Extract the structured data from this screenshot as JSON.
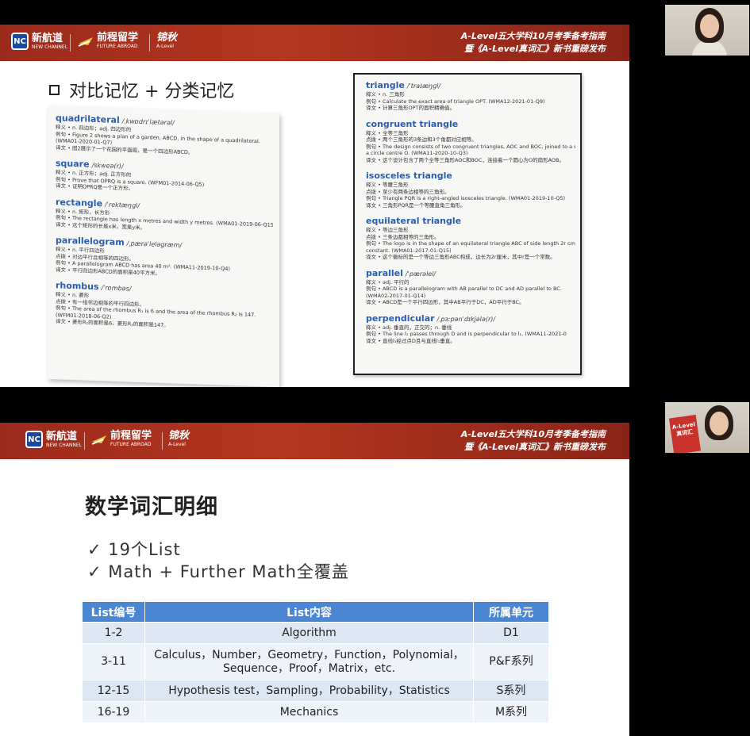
{
  "banner": {
    "logo1_cn": "新航道",
    "logo1_en": "NEW CHANNEL",
    "logo1_mark": "NC",
    "logo2_cn": "前程留学",
    "logo2_en": "FUTURE ABROAD",
    "logo3_cn": "锦秋",
    "logo3_en": "A-Level",
    "title_line1": "A-Level五大学科10月考季备考指南",
    "title_line2": "暨《A-Level真词汇》新书重磅发布"
  },
  "slide1": {
    "heading": "对比记忆 + 分类记忆",
    "left_page": [
      {
        "word": "quadrilateral",
        "phonetic": "/ˌkwɒdrɪˈlætərəl/",
        "lines": [
          "释义 • n. 四边形；adj. 四边形的",
          "例句 • Figure 2 shows a plan of a garden, ABCD, in the shape of a quadrilateral.",
          "(WMA01-2020-01-Q7)",
          "译文 • 图2展示了一个花园的平面图，是一个四边形ABCD。"
        ]
      },
      {
        "word": "square",
        "phonetic": "/skweə(r)/",
        "lines": [
          "释义 • n. 正方形；adj. 正方形的",
          "例句 • Prove that OPRQ is a square. (WFM01-2014-06-Q5)",
          "译文 • 证明OPRQ是一个正方形。"
        ]
      },
      {
        "word": "rectangle",
        "phonetic": "/ˈrektæŋɡl/",
        "lines": [
          "释义 • n. 矩形，长方形",
          "例句 • The rectangle has length x metres and width y metres. (WMA01-2019-06-Q15)",
          "译文 • 这个矩形的长是x米，宽是y米。"
        ]
      },
      {
        "word": "parallelogram",
        "phonetic": "/ˌpærəˈleləɡræm/",
        "lines": [
          "释义 • n. 平行四边形",
          "点拨 • 对边平行且相等的四边形。",
          "例句 • A parallelogram ABCD has area 40 m². (WMA11-2019-10-Q4)",
          "译文 • 平行四边形ABCD的面积是40平方米。"
        ]
      },
      {
        "word": "rhombus",
        "phonetic": "/ˈrɒmbəs/",
        "lines": [
          "释义 • n. 菱形",
          "点拨 • 有一组邻边相等的平行四边形。",
          "例句 • The area of the rhombus R₁ is 6 and the area of the rhombus R₂ is 147.",
          "(WFM01-2018-06-Q2)",
          "译文 • 菱形R₁的面积是6，菱形R₂的面积是147。"
        ]
      }
    ],
    "right_page": [
      {
        "word": "triangle",
        "phonetic": "/ˈtraɪæŋɡl/",
        "lines": [
          "释义 • n. 三角形",
          "例句 • Calculate the exact area of triangle OPT. (WMA12-2021-01-Q9)",
          "译文 • 计算三角形OPT的面积精确值。"
        ]
      },
      {
        "word": "congruent triangle",
        "phonetic": "",
        "lines": [
          "释义 • 全等三角形",
          "点拨 • 两个三角形的3条边和3个角都对应相等。",
          "例句 • The design consists of two congruent triangles, AOC and BOC, joined to a semi",
          "a circle centre O. (WMA11-2020-10-Q3)",
          "译文 • 这个设计包含了两个全等三角形AOC和BOC，连接着一个圆心为O的扇形AOB。"
        ]
      },
      {
        "word": "isosceles triangle",
        "phonetic": "",
        "lines": [
          "释义 • 等腰三角形",
          "点拨 • 至少有两条边相等的三角形。",
          "例句 • Triangle PQR is a right-angled isosceles triangle. (WMA01-2019-10-Q5)",
          "译文 • 三角形PQR是一个等腰直角三角形。"
        ]
      },
      {
        "word": "equilateral triangle",
        "phonetic": "",
        "lines": [
          "释义 • 等边三角形",
          "点拨 • 三条边都相等的三角形。",
          "例句 • The logo is in the shape of an equilateral triangle ABC of side length 2r cm",
          "constant. (WMA01-2017-01-Q15)",
          "译文 • 这个徽标的是一个等边三角形ABC构成，边长为2r厘米，其中r是一个常数。"
        ]
      },
      {
        "word": "parallel",
        "phonetic": "/ˈpærəlel/",
        "lines": [
          "释义 • adj. 平行的",
          "例句 • ABCD is a parallelogram with AB parallel to DC and AD parallel to BC.",
          "(WMA02-2017-01-Q14)",
          "译文 • ABCD是一个平行四边形，其中AB平行于DC，AD平行于BC。"
        ]
      },
      {
        "word": "perpendicular",
        "phonetic": "/ˌpɜːpənˈdɪkjələ(r)/",
        "lines": [
          "释义 • adj. 垂直的，正交的；n. 垂线",
          "例句 • The line l₁ passes through D and is perpendicular to l₁. (WMA11-2021-0",
          "译文 • 直线l₁经过点D且与直线l₁垂直。"
        ]
      }
    ]
  },
  "slide2": {
    "heading": "数学词汇明细",
    "check1": "✓ 19个List",
    "check2": "✓ Math + Further Math全覆盖",
    "table": {
      "headers": [
        "List编号",
        "List内容",
        "所属单元"
      ],
      "rows": [
        [
          "1-2",
          "Algorithm",
          "D1"
        ],
        [
          "3-11",
          "Calculus，Number，Geometry，Function，Polynomial，Sequence，Proof，Matrix，etc.",
          "P&F系列"
        ],
        [
          "12-15",
          "Hypothesis test，Sampling，Probability，Statistics",
          "S系列"
        ],
        [
          "16-19",
          "Mechanics",
          "M系列"
        ]
      ]
    }
  },
  "webcam2_book": "A-Level 真词汇"
}
